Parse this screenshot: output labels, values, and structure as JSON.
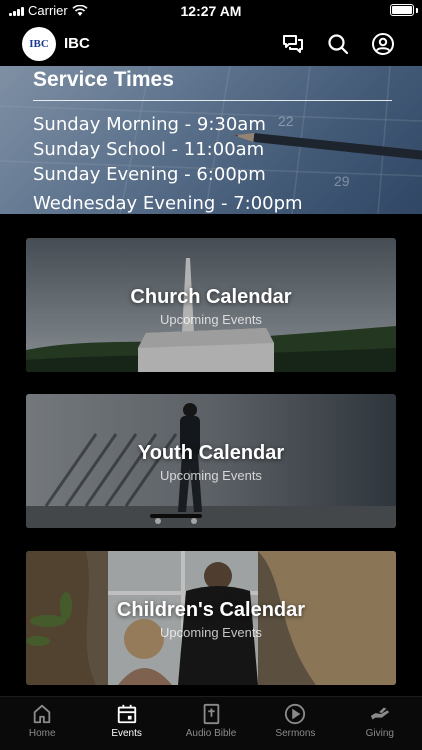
{
  "status": {
    "carrier": "Carrier",
    "time": "12:27 AM"
  },
  "header": {
    "logo_text": "IBC",
    "title": "IBC"
  },
  "banner": {
    "title": "Service Times",
    "lines": [
      "Sunday Morning - 9:30am",
      "Sunday School - 11:00am",
      "Sunday Evening - 6:00pm",
      "Wednesday Evening - 7:00pm"
    ],
    "calendar_numbers": [
      "22",
      "29"
    ]
  },
  "cards": [
    {
      "title": "Church Calendar",
      "subtitle": "Upcoming Events"
    },
    {
      "title": "Youth Calendar",
      "subtitle": "Upcoming Events"
    },
    {
      "title": "Children's Calendar",
      "subtitle": "Upcoming Events"
    }
  ],
  "tabs": [
    {
      "label": "Home",
      "icon": "home-icon",
      "active": false
    },
    {
      "label": "Events",
      "icon": "calendar-icon",
      "active": true
    },
    {
      "label": "Audio Bible",
      "icon": "bible-icon",
      "active": false
    },
    {
      "label": "Sermons",
      "icon": "play-icon",
      "active": false
    },
    {
      "label": "Giving",
      "icon": "giving-icon",
      "active": false
    }
  ],
  "colors": {
    "background": "#000000",
    "tab_active": "#ffffff",
    "tab_inactive": "#8a8a8a",
    "logo_blue": "#1a3a8c"
  }
}
